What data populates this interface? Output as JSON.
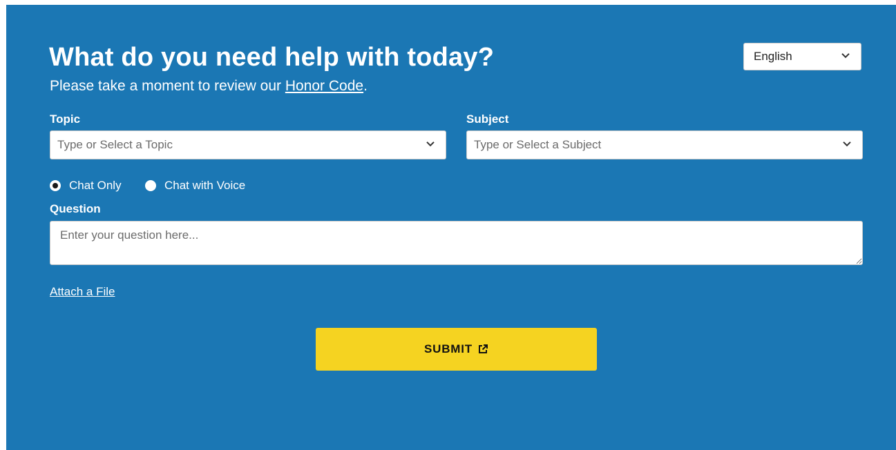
{
  "header": {
    "title": "What do you need help with today?",
    "subtitle_prefix": "Please take a moment to review our ",
    "honor_code_link": "Honor Code",
    "subtitle_suffix": "."
  },
  "language": {
    "selected": "English"
  },
  "topic": {
    "label": "Topic",
    "placeholder": "Type or Select a Topic"
  },
  "subject": {
    "label": "Subject",
    "placeholder": "Type or Select a Subject"
  },
  "mode": {
    "options": [
      {
        "label": "Chat Only",
        "selected": true
      },
      {
        "label": "Chat with Voice",
        "selected": false
      }
    ]
  },
  "question": {
    "label": "Question",
    "placeholder": "Enter your question here..."
  },
  "attach": {
    "label": "Attach a File"
  },
  "submit": {
    "label": "SUBMIT"
  },
  "icons": {
    "chevron": "chevron-down-icon",
    "external": "external-link-icon"
  },
  "colors": {
    "background": "#1b77b4",
    "submit": "#f5d321"
  }
}
